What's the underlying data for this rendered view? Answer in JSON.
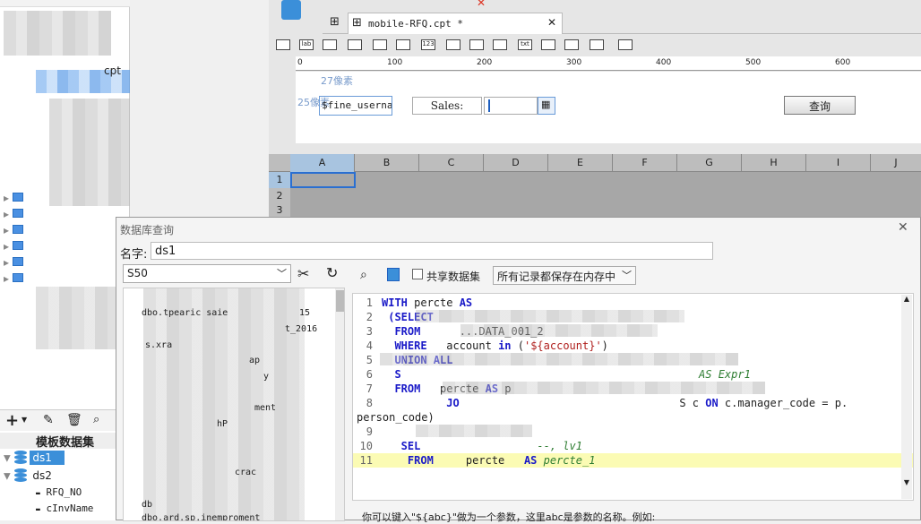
{
  "designer": {
    "tab_title": "mobile-RFQ.cpt *",
    "ruler": [
      "0",
      "100",
      "200",
      "300",
      "400",
      "500",
      "600"
    ],
    "px_label_top": "27像素",
    "px_label_left": "25像素",
    "param_value": "$fine_userna",
    "sales_label": "Sales:",
    "query_button": "查询",
    "columns": [
      "A",
      "B",
      "C",
      "D",
      "E",
      "F",
      "G",
      "H",
      "I",
      "J"
    ],
    "rows": [
      "1",
      "2",
      "3"
    ]
  },
  "left_panel": {
    "file_item": "cpt",
    "dataset_header": "模板数据集",
    "datasets": [
      "ds1",
      "ds2"
    ],
    "fields": [
      "RFQ_NO",
      "cInvName"
    ]
  },
  "dialog": {
    "title": "数据库查询",
    "name_label": "名字:",
    "name_value": "ds1",
    "connection": "S50",
    "share_label": "共享数据集",
    "cache_option": "所有记录都保存在内存中",
    "tables": [
      "dbo.tpearic saie",
      "15",
      "t_2016",
      "s.xra",
      "ap",
      "y",
      "ment",
      "hP",
      "crac",
      "db",
      "dbo.ard.sp.inemproment"
    ],
    "sql_lines": [
      {
        "n": "1",
        "parts": [
          {
            "k": "kw",
            "t": "WITH "
          },
          {
            "k": "",
            "t": "percte "
          },
          {
            "k": "kw",
            "t": "AS"
          }
        ]
      },
      {
        "n": "2",
        "parts": [
          {
            "k": "kw",
            "t": " (SELECT"
          }
        ]
      },
      {
        "n": "3",
        "parts": [
          {
            "k": "kw",
            "t": "  FROM"
          },
          {
            "k": "",
            "t": "      ...DATA_001_2"
          }
        ]
      },
      {
        "n": "4",
        "parts": [
          {
            "k": "kw",
            "t": "  WHERE"
          },
          {
            "k": "",
            "t": "   account "
          },
          {
            "k": "kw",
            "t": "in"
          },
          {
            "k": "",
            "t": " ("
          },
          {
            "k": "str",
            "t": "'${account}'"
          },
          {
            "k": "",
            "t": ")"
          }
        ]
      },
      {
        "n": "5",
        "parts": [
          {
            "k": "kw",
            "t": "  UNION ALL"
          }
        ]
      },
      {
        "n": "6",
        "parts": [
          {
            "k": "kw",
            "t": "  S"
          },
          {
            "k": "cm",
            "t": "                                              AS Expr1"
          }
        ]
      },
      {
        "n": "7",
        "parts": [
          {
            "k": "kw",
            "t": "  FROM"
          },
          {
            "k": "",
            "t": "   percte "
          },
          {
            "k": "kw",
            "t": "AS"
          },
          {
            "k": "",
            "t": " p"
          }
        ]
      },
      {
        "n": "8",
        "parts": [
          {
            "k": "kw",
            "t": "          JO"
          },
          {
            "k": "",
            "t": "                                  S c "
          },
          {
            "k": "kw",
            "t": "ON"
          },
          {
            "k": "",
            "t": " c.manager_code = p."
          }
        ]
      },
      {
        "n": "",
        "parts": [
          {
            "k": "",
            "t": "person_code)"
          }
        ]
      },
      {
        "n": "9",
        "parts": []
      },
      {
        "n": "10",
        "parts": [
          {
            "k": "kw",
            "t": "   SEL"
          },
          {
            "k": "cm",
            "t": "                  --, lv1"
          }
        ]
      },
      {
        "n": "11",
        "parts": [
          {
            "k": "kw",
            "t": "    FROM"
          },
          {
            "k": "",
            "t": "     percte   "
          },
          {
            "k": "kw",
            "t": "AS"
          },
          {
            "k": "cm",
            "t": " percte_1"
          }
        ]
      }
    ],
    "hint": "你可以键入\"${abc}\"做为一个参数，这里abc是参数的名称。例如:"
  }
}
